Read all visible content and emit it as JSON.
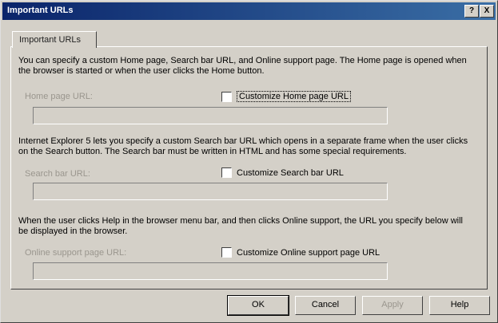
{
  "window": {
    "title": "Important URLs",
    "help_glyph": "?",
    "close_glyph": "X"
  },
  "tab": {
    "label": "Important URLs"
  },
  "home": {
    "description": "You can specify a custom Home page, Search bar URL, and Online support page. The Home page is opened when the browser is started or when the user clicks the Home button.",
    "label": "Home page URL:",
    "checkbox_label": "Customize Home page URL",
    "checked": false,
    "value": ""
  },
  "search": {
    "description": "Internet Explorer 5 lets you specify a custom Search bar URL which opens in a separate frame when the user clicks on the Search button. The Search bar must be written in HTML and has some special requirements.",
    "label": "Search bar URL:",
    "checkbox_label": "Customize Search bar URL",
    "checked": false,
    "value": ""
  },
  "support": {
    "description": "When the user clicks Help in the browser menu bar, and then clicks Online support, the URL you specify below will be displayed in the browser.",
    "label": "Online support page URL:",
    "checkbox_label": "Customize Online support page URL",
    "checked": false,
    "value": ""
  },
  "buttons": {
    "ok": "OK",
    "cancel": "Cancel",
    "apply": "Apply",
    "help": "Help"
  }
}
